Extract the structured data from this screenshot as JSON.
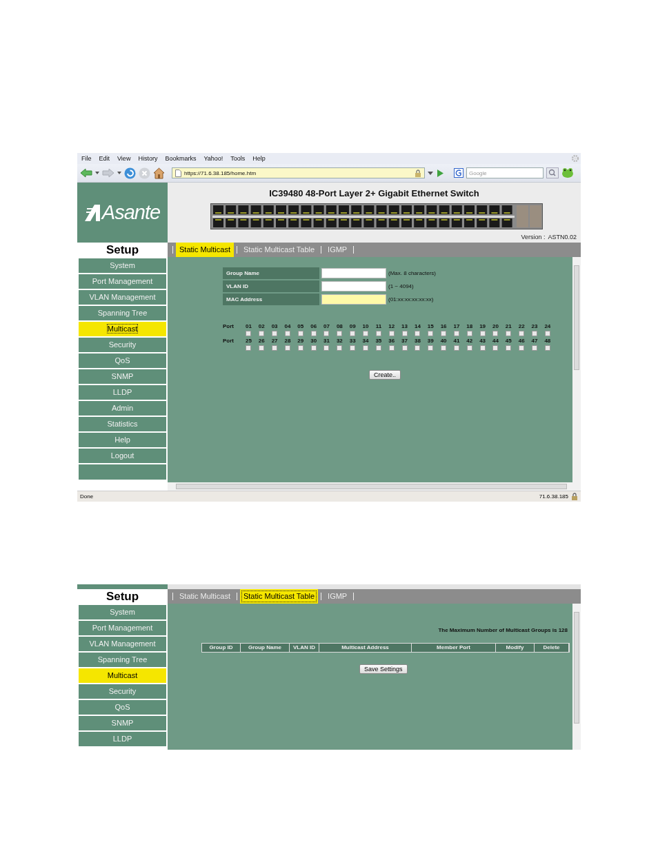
{
  "first_screenshot": {
    "browser": {
      "menu": [
        "File",
        "Edit",
        "View",
        "History",
        "Bookmarks",
        "Yahoo!",
        "Tools",
        "Help"
      ],
      "url": "https://71.6.38.185/home.htm",
      "search": {
        "placeholder": "Google"
      }
    },
    "header": {
      "logo": "Asante",
      "title": "IC39480 48-Port Layer 2+ Gigabit Ethernet Switch",
      "version_label": "Version :",
      "version": "ASTN0.02"
    },
    "sidebar": {
      "heading": "Setup",
      "items": [
        {
          "label": "System",
          "selected": false
        },
        {
          "label": "Port Management",
          "selected": false
        },
        {
          "label": "VLAN Management",
          "selected": false
        },
        {
          "label": "Spanning Tree",
          "selected": false
        },
        {
          "label": "Multicast",
          "selected": true
        },
        {
          "label": "Security",
          "selected": false
        },
        {
          "label": "QoS",
          "selected": false
        },
        {
          "label": "SNMP",
          "selected": false
        },
        {
          "label": "LLDP",
          "selected": false
        },
        {
          "label": "Admin",
          "selected": false
        },
        {
          "label": "Statistics",
          "selected": false
        },
        {
          "label": "Help",
          "selected": false
        },
        {
          "label": "Logout",
          "selected": false
        }
      ]
    },
    "tabs": [
      {
        "label": "Static Multicast",
        "selected": true
      },
      {
        "label": "Static Multicast Table",
        "selected": false
      },
      {
        "label": "IGMP",
        "selected": false
      }
    ],
    "form": {
      "fields": [
        {
          "label": "Group Name",
          "hint": "(Max. 8 characters)",
          "highlighted": false
        },
        {
          "label": "VLAN ID",
          "hint": "(1 ~ 4094)",
          "highlighted": false
        },
        {
          "label": "MAC Address",
          "hint": "(01:xx:xx:xx:xx:xx)",
          "highlighted": true
        }
      ],
      "port_rows": [
        {
          "label": "Port",
          "ports": [
            {
              "number": "01",
              "checked": false
            },
            {
              "number": "02",
              "checked": false
            },
            {
              "number": "03",
              "checked": false
            },
            {
              "number": "04",
              "checked": false
            },
            {
              "number": "05",
              "checked": false
            },
            {
              "number": "06",
              "checked": false
            },
            {
              "number": "07",
              "checked": false
            },
            {
              "number": "08",
              "checked": false
            },
            {
              "number": "09",
              "checked": false
            },
            {
              "number": "10",
              "checked": false
            },
            {
              "number": "11",
              "checked": false
            },
            {
              "number": "12",
              "checked": false
            },
            {
              "number": "13",
              "checked": false
            },
            {
              "number": "14",
              "checked": false
            },
            {
              "number": "15",
              "checked": false
            },
            {
              "number": "16",
              "checked": false
            },
            {
              "number": "17",
              "checked": false
            },
            {
              "number": "18",
              "checked": false
            },
            {
              "number": "19",
              "checked": false
            },
            {
              "number": "20",
              "checked": false
            },
            {
              "number": "21",
              "checked": false
            },
            {
              "number": "22",
              "checked": false
            },
            {
              "number": "23",
              "checked": false
            },
            {
              "number": "24",
              "checked": false
            }
          ]
        },
        {
          "label": "Port",
          "ports": [
            {
              "number": "25",
              "checked": false
            },
            {
              "number": "26",
              "checked": false
            },
            {
              "number": "27",
              "checked": false
            },
            {
              "number": "28",
              "checked": false
            },
            {
              "number": "29",
              "checked": false
            },
            {
              "number": "30",
              "checked": false
            },
            {
              "number": "31",
              "checked": false
            },
            {
              "number": "32",
              "checked": false
            },
            {
              "number": "33",
              "checked": false
            },
            {
              "number": "34",
              "checked": false
            },
            {
              "number": "35",
              "checked": false
            },
            {
              "number": "36",
              "checked": false
            },
            {
              "number": "37",
              "checked": false
            },
            {
              "number": "38",
              "checked": false
            },
            {
              "number": "39",
              "checked": false
            },
            {
              "number": "40",
              "checked": false
            },
            {
              "number": "41",
              "checked": false
            },
            {
              "number": "42",
              "checked": false
            },
            {
              "number": "43",
              "checked": false
            },
            {
              "number": "44",
              "checked": false
            },
            {
              "number": "45",
              "checked": false
            },
            {
              "number": "46",
              "checked": false
            },
            {
              "number": "47",
              "checked": false
            },
            {
              "number": "48",
              "checked": false
            }
          ]
        }
      ],
      "button": "Create.."
    },
    "status_bar": {
      "status": "Done",
      "address": "71.6.38.185"
    }
  },
  "second_screenshot": {
    "sidebar": {
      "heading": "Setup",
      "items": [
        {
          "label": "System",
          "selected": false
        },
        {
          "label": "Port Management",
          "selected": false
        },
        {
          "label": "VLAN Management",
          "selected": false
        },
        {
          "label": "Spanning Tree",
          "selected": false
        },
        {
          "label": "Multicast",
          "selected": true
        },
        {
          "label": "Security",
          "selected": false
        },
        {
          "label": "QoS",
          "selected": false
        },
        {
          "label": "SNMP",
          "selected": false
        },
        {
          "label": "LLDP",
          "selected": false
        }
      ]
    },
    "tabs": [
      {
        "label": "Static Multicast",
        "selected": false
      },
      {
        "label": "Static Multicast Table",
        "selected": true
      },
      {
        "label": "IGMP",
        "selected": false
      }
    ],
    "table": {
      "note": "The Maximum Number of Multicast Groups is 128",
      "columns": [
        "Group ID",
        "Group Name",
        "VLAN ID",
        "Multicast Address",
        "Member Port",
        "Modify",
        "Delete"
      ],
      "button": "Save Settings"
    }
  }
}
